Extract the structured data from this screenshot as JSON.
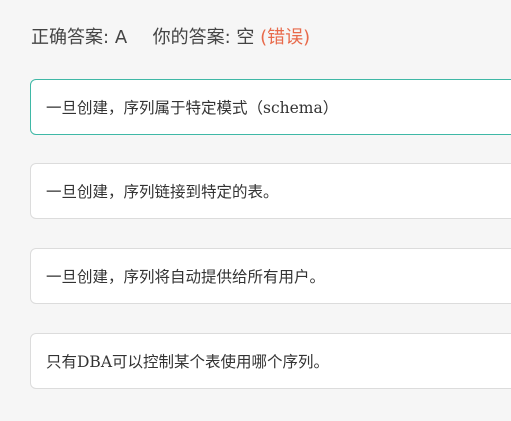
{
  "result": {
    "correct_label": "正确答案:",
    "correct_value": "A",
    "your_label": "你的答案:",
    "your_value": "空",
    "status": "(错误)"
  },
  "options": [
    {
      "text": "一旦创建，序列属于特定模式（schema）",
      "highlighted": true
    },
    {
      "text": "一旦创建，序列链接到特定的表。",
      "highlighted": false
    },
    {
      "text": "一旦创建，序列将自动提供给所有用户。",
      "highlighted": false
    },
    {
      "text": "只有DBA可以控制某个表使用哪个序列。",
      "highlighted": false
    }
  ],
  "colors": {
    "highlight_border": "#3fb8a6",
    "error_text": "#e86a4b"
  }
}
